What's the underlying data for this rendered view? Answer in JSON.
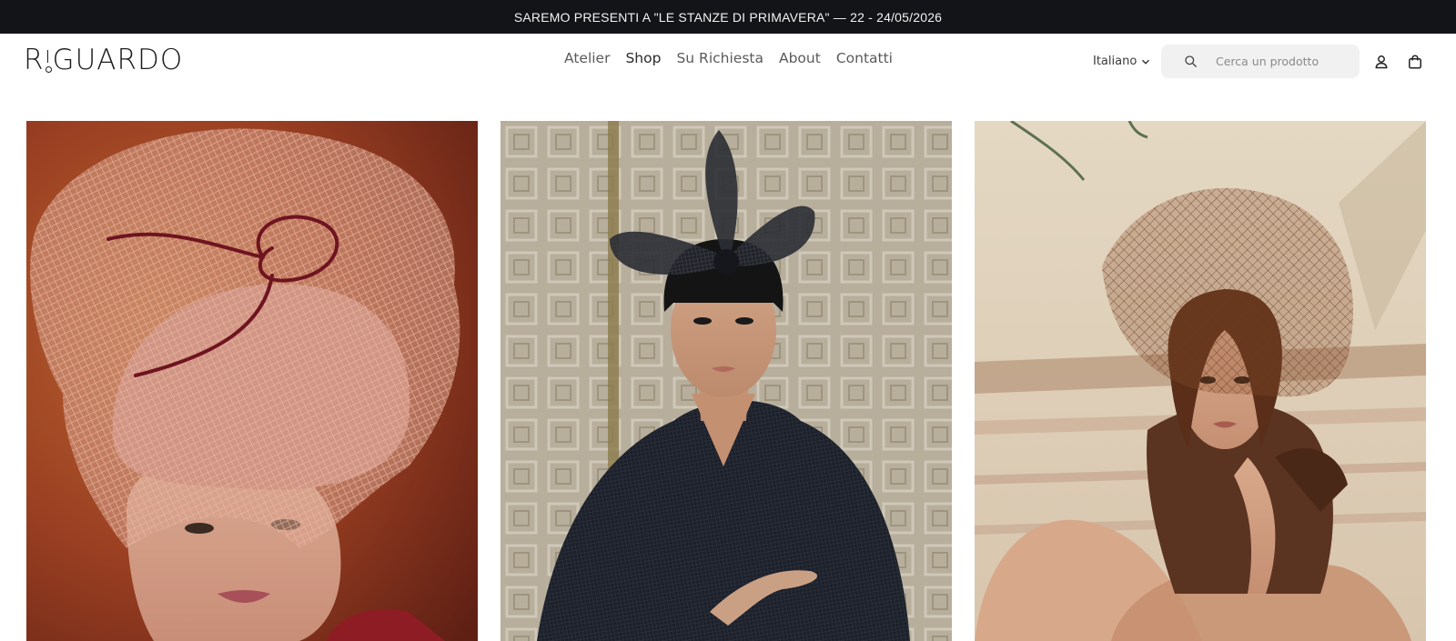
{
  "announcement": {
    "text": "SAREMO PRESENTI A \"LE STANZE DI PRIMAVERA\" — 22 - 24/05/2026"
  },
  "header": {
    "logo": {
      "before": "R",
      "after": "GUARDO",
      "full": "RIGUARDO"
    },
    "nav": [
      {
        "label": "Atelier"
      },
      {
        "label": "Shop"
      },
      {
        "label": "Su Richiesta"
      },
      {
        "label": "About"
      },
      {
        "label": "Contatti"
      }
    ],
    "language": {
      "selected": "Italiano",
      "icon": "chevron-down-icon"
    },
    "search": {
      "placeholder": "Cerca un prodotto",
      "value": "",
      "icon": "search-icon"
    },
    "icons": {
      "account": "user-icon",
      "cart": "shopping-bag-icon"
    }
  },
  "gallery": {
    "images": [
      {
        "alt": "Model wearing large blush tulle veil headpiece",
        "icon": "product-photo"
      },
      {
        "alt": "Model wearing black sinamay bow fascinator",
        "icon": "product-photo"
      },
      {
        "alt": "Model with brown birdcage veil headpiece",
        "icon": "product-photo"
      }
    ]
  },
  "colors": {
    "announcement_bg": "#121417",
    "announcement_text": "#f2f2f2",
    "search_bg": "#f1f1f1"
  }
}
